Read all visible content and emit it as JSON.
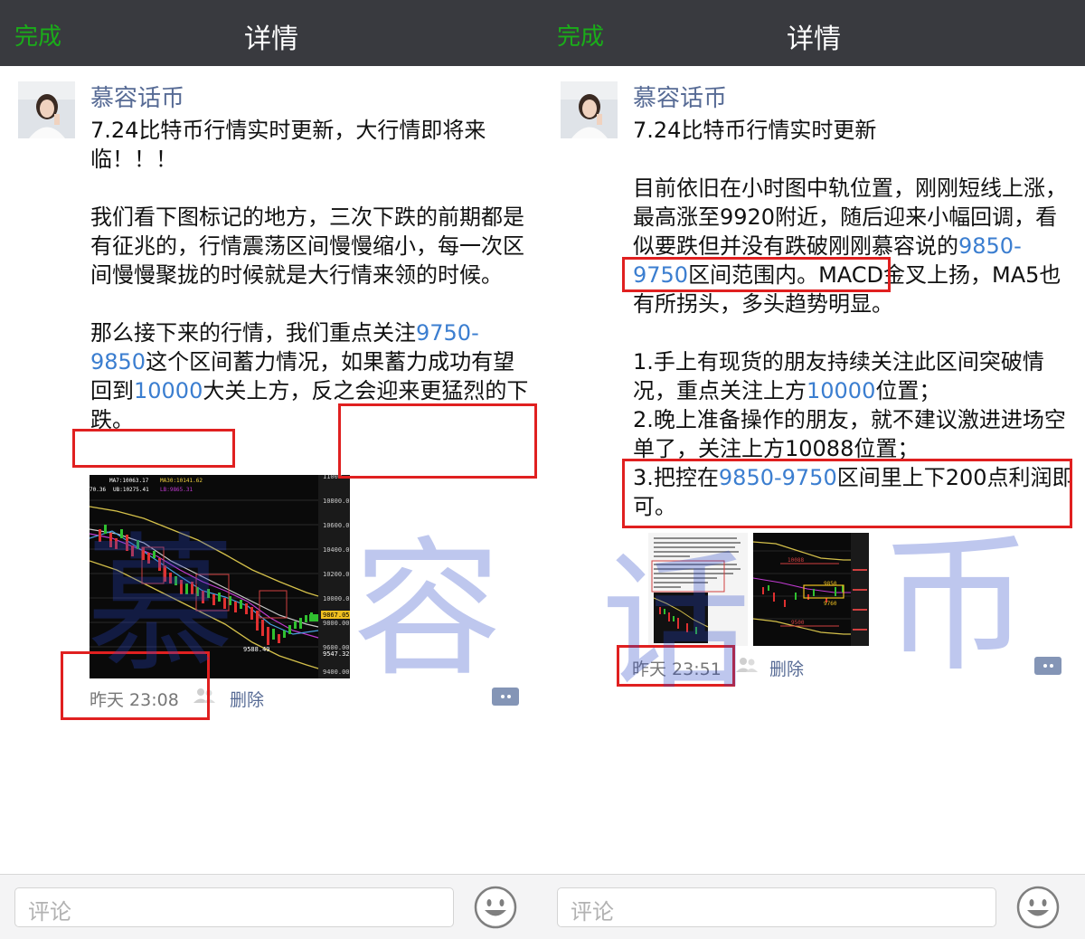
{
  "left": {
    "nav": {
      "done": "完成",
      "title": "详情"
    },
    "username": "慕容话币",
    "text": {
      "p1": "7.24比特币行情实时更新，大行情即将来临！！！\n\n我们看下图标记的地方，三次下跌的前期都是有征兆的，行情震荡区间慢慢缩小，每一次区间慢慢聚拢的时候就是大行情来领的时候。\n\n那么接下来的行情，我们重点关注",
      "link1": "9750-9850",
      "p2": "这个区间蓄力情况，如果蓄力成功有望回到",
      "link2": "10000",
      "p3": "大关上方，反之会迎来更猛烈的下跌。"
    },
    "chart_thumb": {
      "ma7": "MA7:10063.17",
      "ma30": "MA30:10141.62",
      "ma_left": "70.36",
      "ub": "UB:10275.41",
      "lb": "LB:9865.31",
      "price_labels": [
        "11000",
        "10800.00",
        "10600.00",
        "10400.00",
        "10200.00",
        "10000.00",
        "9800.00",
        "9600.00",
        "9400.00"
      ],
      "current_price": "9867.05",
      "low_label": "9588.49",
      "low_price": "9547.32"
    },
    "meta": {
      "time": "昨天 23:08",
      "delete": "删除"
    },
    "comment_placeholder": "评论"
  },
  "right": {
    "nav": {
      "done": "完成",
      "title": "详情"
    },
    "username": "慕容话币",
    "text": {
      "p1": "7.24比特币行情实时更新\n\n目前依旧在小时图中轨位置，刚刚短线上涨，最高涨至9920附近，随后迎来小幅回调，看似要跌但并没有跌破刚刚慕容说的",
      "link1": "9850-9750",
      "p2": "区间范围内。MACD金叉上扬，MA5也有所拐头，多头趋势明显。\n\n1.手上有现货的朋友持续关注此区间突破情况，重点关注上方",
      "link2": "10000",
      "p3": "位置；\n2.晚上准备操作的朋友，就不建议激进进场空单了，关注上方10088位置；\n3.把控在",
      "link3": "9850-9750",
      "p4": "区间里上下200点利润即可。"
    },
    "thumb2": {
      "labels": [
        "10088",
        "9850",
        "9760",
        "9500"
      ]
    },
    "meta": {
      "time": "昨天 23:51",
      "delete": "删除"
    },
    "comment_placeholder": "评论"
  },
  "watermark": [
    "慕",
    "容",
    "话",
    "币"
  ],
  "colors": {
    "green": "#1aad19",
    "nav_bg": "#393a3f",
    "link": "#576b95",
    "blue": "#3b7ed0",
    "red": "#e02020"
  }
}
